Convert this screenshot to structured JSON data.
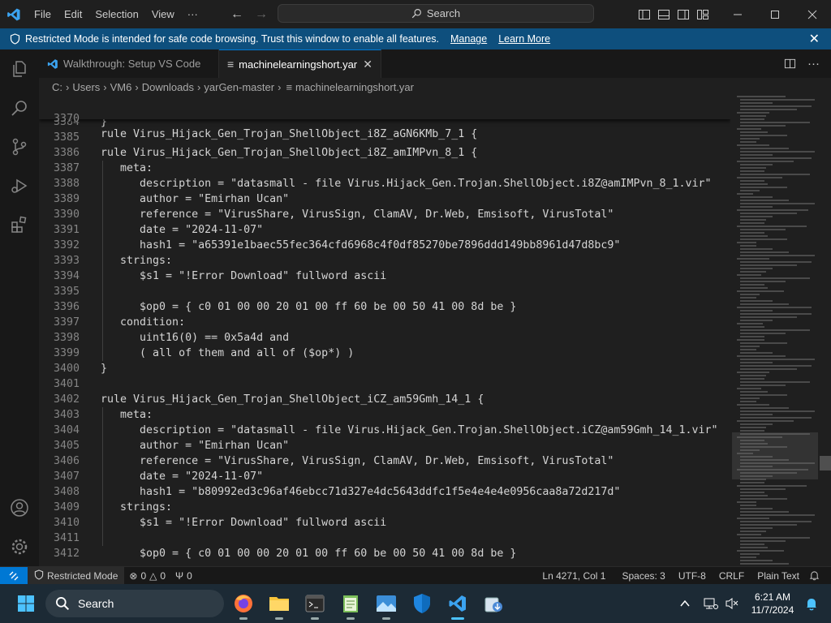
{
  "titlebar": {
    "menu": [
      "File",
      "Edit",
      "Selection",
      "View",
      "···"
    ],
    "search_label": "Search"
  },
  "banner": {
    "message": "Restricted Mode is intended for safe code browsing. Trust this window to enable all features.",
    "manage": "Manage",
    "learn_more": "Learn More"
  },
  "tabs": [
    {
      "label": "Walkthrough: Setup VS Code",
      "active": false
    },
    {
      "label": "machinelearningshort.yar",
      "active": true
    }
  ],
  "breadcrumb": [
    "C:",
    "Users",
    "VM6",
    "Downloads",
    "yarGen-master",
    "machinelearningshort.yar"
  ],
  "editor": {
    "sticky": {
      "num": "3370",
      "text": "rule Virus_Hijack_Gen_Trojan_ShellObject_i8Z_aGN6KMb_7_1 {"
    },
    "lines": [
      {
        "num": "3384",
        "text": "}"
      },
      {
        "num": "3385",
        "text": ""
      },
      {
        "num": "3386",
        "text": "rule Virus_Hijack_Gen_Trojan_ShellObject_i8Z_amIMPvn_8_1 {"
      },
      {
        "num": "3387",
        "text": "   meta:"
      },
      {
        "num": "3388",
        "text": "      description = \"datasmall - file Virus.Hijack_Gen.Trojan.ShellObject.i8Z@amIMPvn_8_1.vir\""
      },
      {
        "num": "3389",
        "text": "      author = \"Emirhan Ucan\""
      },
      {
        "num": "3390",
        "text": "      reference = \"VirusShare, VirusSign, ClamAV, Dr.Web, Emsisoft, VirusTotal\""
      },
      {
        "num": "3391",
        "text": "      date = \"2024-11-07\""
      },
      {
        "num": "3392",
        "text": "      hash1 = \"a65391e1baec55fec364cfd6968c4f0df85270be7896ddd149bb8961d47d8bc9\""
      },
      {
        "num": "3393",
        "text": "   strings:"
      },
      {
        "num": "3394",
        "text": "      $s1 = \"!Error Download\" fullword ascii"
      },
      {
        "num": "3395",
        "text": ""
      },
      {
        "num": "3396",
        "text": "      $op0 = { c0 01 00 00 20 01 00 ff 60 be 00 50 41 00 8d be }"
      },
      {
        "num": "3397",
        "text": "   condition:"
      },
      {
        "num": "3398",
        "text": "      uint16(0) == 0x5a4d and"
      },
      {
        "num": "3399",
        "text": "      ( all of them and all of ($op*) )"
      },
      {
        "num": "3400",
        "text": "}"
      },
      {
        "num": "3401",
        "text": ""
      },
      {
        "num": "3402",
        "text": "rule Virus_Hijack_Gen_Trojan_ShellObject_iCZ_am59Gmh_14_1 {"
      },
      {
        "num": "3403",
        "text": "   meta:"
      },
      {
        "num": "3404",
        "text": "      description = \"datasmall - file Virus.Hijack_Gen.Trojan.ShellObject.iCZ@am59Gmh_14_1.vir\""
      },
      {
        "num": "3405",
        "text": "      author = \"Emirhan Ucan\""
      },
      {
        "num": "3406",
        "text": "      reference = \"VirusShare, VirusSign, ClamAV, Dr.Web, Emsisoft, VirusTotal\""
      },
      {
        "num": "3407",
        "text": "      date = \"2024-11-07\""
      },
      {
        "num": "3408",
        "text": "      hash1 = \"b80992ed3c96af46ebcc71d327e4dc5643ddfc1f5e4e4e4e0956caa8a72d217d\""
      },
      {
        "num": "3409",
        "text": "   strings:"
      },
      {
        "num": "3410",
        "text": "      $s1 = \"!Error Download\" fullword ascii"
      },
      {
        "num": "3411",
        "text": ""
      },
      {
        "num": "3412",
        "text": "      $op0 = { c0 01 00 00 20 01 00 ff 60 be 00 50 41 00 8d be }"
      }
    ]
  },
  "statusbar": {
    "restricted": "Restricted Mode",
    "errors": "0",
    "warnings": "0",
    "ports": "0",
    "position": "Ln 4271, Col 1",
    "spaces": "Spaces: 3",
    "encoding": "UTF-8",
    "eol": "CRLF",
    "language": "Plain Text"
  },
  "taskbar": {
    "search_label": "Search",
    "time": "6:21 AM",
    "date": "11/7/2024"
  },
  "colors": {
    "accent": "#0078d4",
    "banner": "#0e4f7d",
    "editor_bg": "#1f1f1f",
    "taskbar": "#1c2a35"
  }
}
